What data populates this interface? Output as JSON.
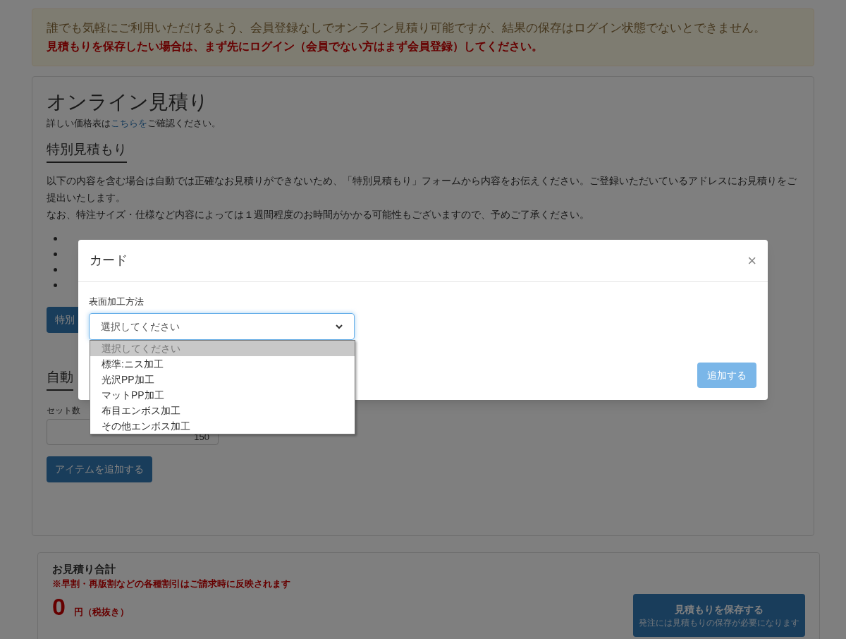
{
  "notice": {
    "text": "誰でも気軽にご利用いただけるよう、会員登録なしでオンライン見積り可能ですが、結果の保存はログイン状態でないとできません。",
    "warning": "見積もりを保存したい場合は、まず先にログイン（会員でない方はまず会員登録）してください。"
  },
  "estimate": {
    "title": "オンライン見積り",
    "price_note_before": "詳しい価格表は",
    "price_link": "こちらを",
    "price_note_after": "ご確認ください。",
    "special": {
      "heading": "特別見積もり",
      "paragraph_1": "以下の内容を含む場合は自動では正確なお見積りができないため、「特別見積もり」フォームから内容をお伝えください。ご登録いただいているアドレスにお見積りをご提出いたします。",
      "paragraph_2": "なお、特注サイズ・仕様など内容によっては１週間程度のお時間がかかる可能性もございますので、予めご了承ください。",
      "button": "特別"
    },
    "auto": {
      "heading": "自動",
      "set_label": "セット数",
      "set_value": "150",
      "add_button": "アイテムを追加する"
    }
  },
  "total": {
    "heading": "お見積り合計",
    "note": "※早割・再版割などの各種割引はご請求時に反映されます",
    "amount": "0",
    "unit": "円（税抜き）",
    "save_button": "見積もりを保存する",
    "save_sub": "発注には見積もりの保存が必要になります"
  },
  "modal": {
    "title": "カード",
    "close": "×",
    "field_label": "表面加工方法",
    "select_value": "選択してください",
    "submit": "追加する",
    "options": [
      {
        "label": "選択してください",
        "selected": true
      },
      {
        "label": "標準:ニス加工",
        "selected": false
      },
      {
        "label": "光沢PP加工",
        "selected": false
      },
      {
        "label": "マットPP加工",
        "selected": false
      },
      {
        "label": "布目エンボス加工",
        "selected": false
      },
      {
        "label": "その他エンボス加工",
        "selected": false
      }
    ]
  }
}
